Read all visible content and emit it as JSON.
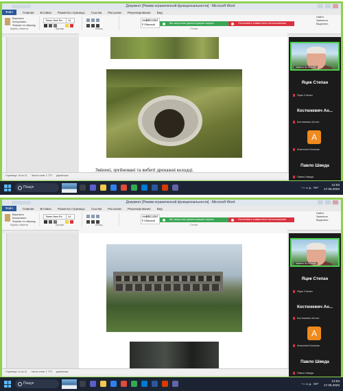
{
  "shots": [
    {
      "window_title": "Документ [Режим ограниченной функциональности] - Microsoft Word",
      "tabs": [
        "Файл",
        "Главная",
        "Вставка",
        "Разметка страницы",
        "Ссылки",
        "Рассылки",
        "Рецензирование",
        "Вид"
      ],
      "font_name": "Times New Ro",
      "font_size": "14",
      "style_sample": "AaBbCcDd",
      "styles": [
        "¶ Обычный",
        "AaBbCcDd",
        "AaBbC"
      ],
      "ribbon_groups": [
        "Буфер обмена",
        "Шрифт",
        "Абзац",
        "Стили",
        "Редактирование"
      ],
      "clipboard_items": [
        "Вырезать",
        "Копировать",
        "Формат по образцу"
      ],
      "editing_items": [
        "Найти",
        "Заменить",
        "Выделить"
      ],
      "notif_green": "Вы запустили демонстрацию экрана",
      "notif_red": "Остановить совместное использование",
      "caption": "Змінені, зруйновані та вибиті дренажні колодці.",
      "status": [
        "Страница: 10 из 11",
        "Число слов: 1 773",
        "українська"
      ],
      "participants": [
        {
          "name": "Яцик Степан",
          "sub": "Яцик Степан"
        },
        {
          "name": "Костюкевич Ан...",
          "sub": "Костюкевич Антон"
        },
        {
          "name": "",
          "sub": "Анастасія Каличак",
          "avatar": "A"
        },
        {
          "name": "Павло Шведа",
          "sub": "Павло Шведа"
        }
      ],
      "video_label": "Микола ВОЛОШИН",
      "search": "Пошук",
      "time": "12:53",
      "date": "17.05.2023",
      "lang": "УКР"
    },
    {
      "window_title": "Документ [Режим ограниченной функциональности] - Microsoft Word",
      "tabs": [
        "Файл",
        "Главная",
        "Вставка",
        "Разметка страницы",
        "Ссылки",
        "Рассылки",
        "Рецензирование",
        "Вид"
      ],
      "font_name": "Times New Ro",
      "font_size": "14",
      "style_sample": "AaBbCcDd",
      "styles": [
        "¶ Обычный",
        "AaBbCcDd",
        "AaBbC"
      ],
      "ribbon_groups": [
        "Буфер обмена",
        "Шрифт",
        "Абзац",
        "Стили",
        "Редактирование"
      ],
      "clipboard_items": [
        "Вырезать",
        "Копировать",
        "Формат по образцу"
      ],
      "editing_items": [
        "Найти",
        "Заменить",
        "Выделить"
      ],
      "notif_green": "Вы запустили демонстрацию экрана",
      "notif_red": "Остановить совместное использование",
      "caption": "",
      "status": [
        "Страница: 11 из 11",
        "Число слов: 1 773",
        "українська"
      ],
      "participants": [
        {
          "name": "Яцик Степан",
          "sub": "Яцик Степан"
        },
        {
          "name": "Костюкевич Ан...",
          "sub": "Костюкевич Антон"
        },
        {
          "name": "",
          "sub": "Анастасія Каличак",
          "avatar": "A"
        },
        {
          "name": "Павло Шведа",
          "sub": "Павло Шведа"
        }
      ],
      "video_label": "Микола ВОЛОШИН",
      "search": "Пошук",
      "time": "12:53",
      "date": "17.05.2023",
      "lang": "УКР"
    }
  ]
}
